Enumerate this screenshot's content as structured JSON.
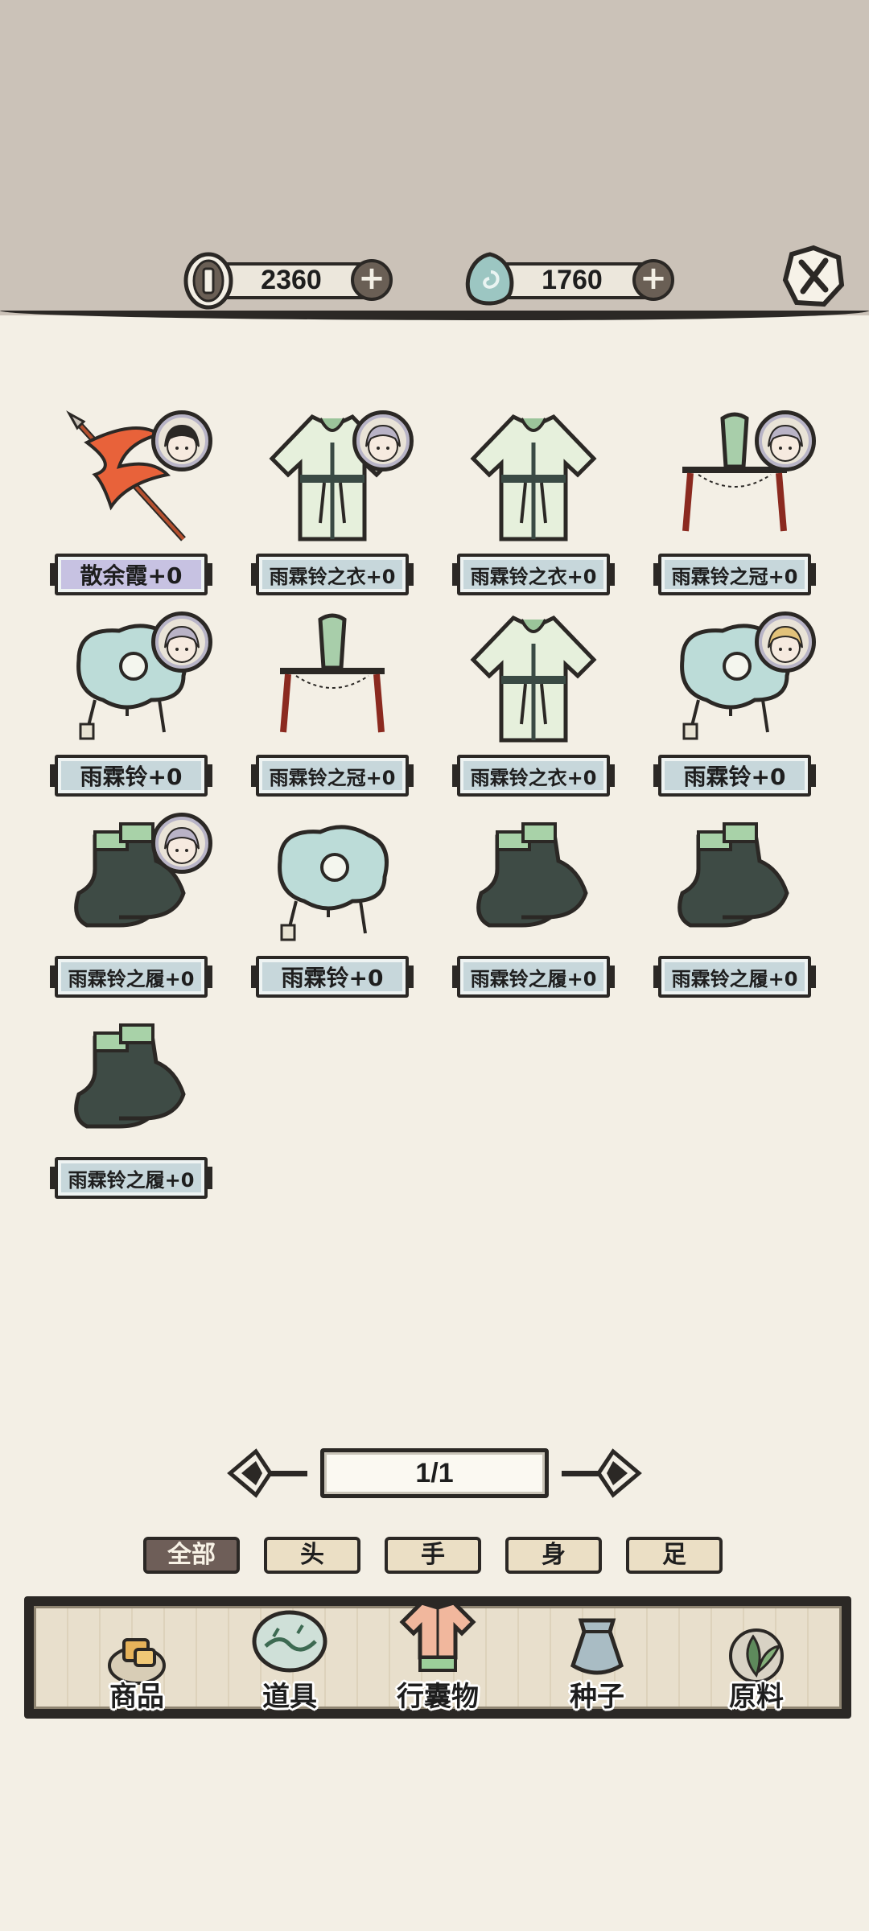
{
  "currencies": {
    "coins": {
      "amount": "2360",
      "icon": "coin-icon"
    },
    "jade": {
      "amount": "1760",
      "icon": "jade-icon"
    }
  },
  "items": [
    {
      "name": "散余霞+0",
      "type": "weapon",
      "avatar": "dark-hair"
    },
    {
      "name": "雨霖铃之衣+0",
      "type": "robe",
      "avatar": "silver-hair"
    },
    {
      "name": "雨霖铃之衣+0",
      "type": "robe",
      "avatar": ""
    },
    {
      "name": "雨霖铃之冠+0",
      "type": "crown",
      "avatar": "silver-hair"
    },
    {
      "name": "雨霖铃+0",
      "type": "charm",
      "avatar": "silver-hair"
    },
    {
      "name": "雨霖铃之冠+0",
      "type": "crown",
      "avatar": ""
    },
    {
      "name": "雨霖铃之衣+0",
      "type": "robe",
      "avatar": ""
    },
    {
      "name": "雨霖铃+0",
      "type": "charm",
      "avatar": "blonde-hair"
    },
    {
      "name": "雨霖铃之履+0",
      "type": "boots",
      "avatar": "silver-hair"
    },
    {
      "name": "雨霖铃+0",
      "type": "charm",
      "avatar": ""
    },
    {
      "name": "雨霖铃之履+0",
      "type": "boots",
      "avatar": ""
    },
    {
      "name": "雨霖铃之履+0",
      "type": "boots",
      "avatar": ""
    },
    {
      "name": "雨霖铃之履+0",
      "type": "boots",
      "avatar": ""
    }
  ],
  "pager": {
    "text": "1/1"
  },
  "filters": [
    "全部",
    "头",
    "手",
    "身",
    "足"
  ],
  "nav": [
    "商品",
    "道具",
    "行囊物",
    "种子",
    "原料"
  ],
  "colors": {
    "accent": "#6e5e58",
    "label_bg": "#c7d7db",
    "label_special": "#c7c2e2"
  }
}
